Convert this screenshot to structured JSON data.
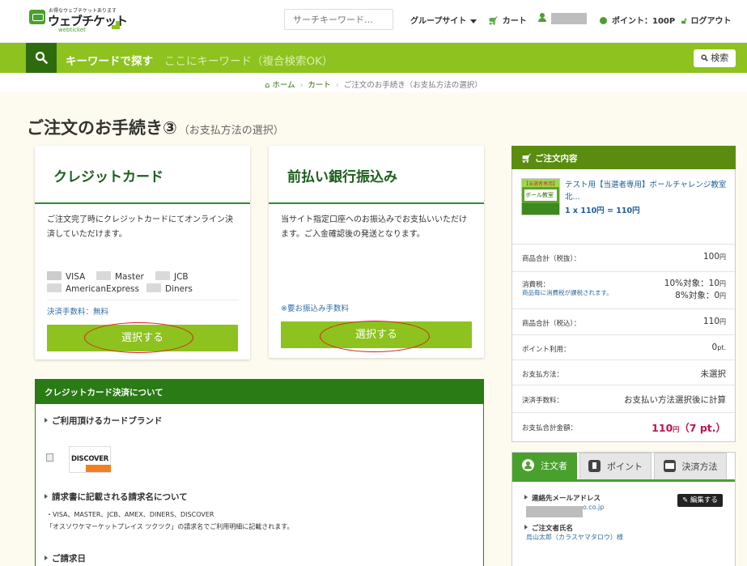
{
  "header": {
    "logo_tagline": "お得なウェブチケットあります",
    "logo_name": "ウェブチケット",
    "logo_sub": "webticket",
    "search_placeholder": "サーチキーワード…",
    "group_sites": "グループサイト",
    "cart": "カート",
    "points": "ポイント：100P",
    "logout": "ログアウト"
  },
  "keyword_bar": {
    "label": "キーワードで探す",
    "placeholder": "ここにキーワード（複合検索OK）",
    "search_button": "検索"
  },
  "breadcrumb": {
    "home": "ホーム",
    "cart": "カート",
    "current": "ご注文のお手続き（お支払方法の選択）"
  },
  "page": {
    "title": "ご注文のお手続き③",
    "subtitle": "（お支払方法の選択）"
  },
  "credit_card": {
    "title": "クレジットカード",
    "description": "ご注文完了時にクレジットカードにてオンライン決済していただけます。",
    "brands": [
      "VISA",
      "Master",
      "JCB",
      "AmericanExpress",
      "Diners"
    ],
    "fee": "決済手数料：無料",
    "select_button": "選択する"
  },
  "bank_transfer": {
    "title": "前払い銀行振込み",
    "description": "当サイト指定口座へのお振込みでお支払いいただけます。ご入金確認後の発送となります。",
    "fee": "※要お振込み手数料",
    "select_button": "選択する"
  },
  "card_info": {
    "header": "クレジットカード決済について",
    "brands_heading": "ご利用頂けるカードブランド",
    "discover_logo": "DISCOVER",
    "billing_heading": "請求書に記載される請求名について",
    "billing_brands": "・VISA、MASTER、JCB、AMEX、DINERS、DISCOVER",
    "billing_note": "「オスソワケマーケットプレイス ツクツク」の請求名でご利用明細に記載されます。",
    "billing_date_heading": "ご請求日"
  },
  "order_summary": {
    "header": "ご注文内容",
    "product_name": "テスト用【当選者専用】ボールチャレンジ教室 北...",
    "product_qty": "1 x 110円 = 110円",
    "thumb_tag": "【当選者専用】",
    "thumb_title": "ボール教室",
    "rows": [
      {
        "label": "商品合計（税抜）：",
        "value": "100",
        "unit": "円"
      },
      {
        "label": "消費税：",
        "note": "商品毎に消費税が課税されます。",
        "value1": "10%対象：10",
        "value2": "8%対象：0",
        "unit": "円"
      },
      {
        "label": "商品合計（税込）：",
        "value": "110",
        "unit": "円"
      },
      {
        "label": "ポイント利用：",
        "value": "0",
        "unit": "pt."
      },
      {
        "label": "お支払方法：",
        "value": "未選択"
      },
      {
        "label": "決済手数料：",
        "value": "お支払い方法選択後に計算"
      },
      {
        "label": "お支払合計金額：",
        "value": "110",
        "unit": "円",
        "points": "（7 pt.）"
      }
    ]
  },
  "tabs": {
    "items": [
      "注文者",
      "ポイント",
      "決済方法"
    ],
    "edit_button": "編集する",
    "email_heading": "連絡先メールアドレス",
    "email_suffix": "o.co.jp",
    "name_heading": "ご注文者氏名",
    "name_value": "烏山太郎（カラスヤマタロウ）様"
  },
  "colors": {
    "accent_green": "#8dc21f",
    "dark_green": "#2e6b0f",
    "highlight_red": "#d92020",
    "price_red": "#c0104f"
  }
}
